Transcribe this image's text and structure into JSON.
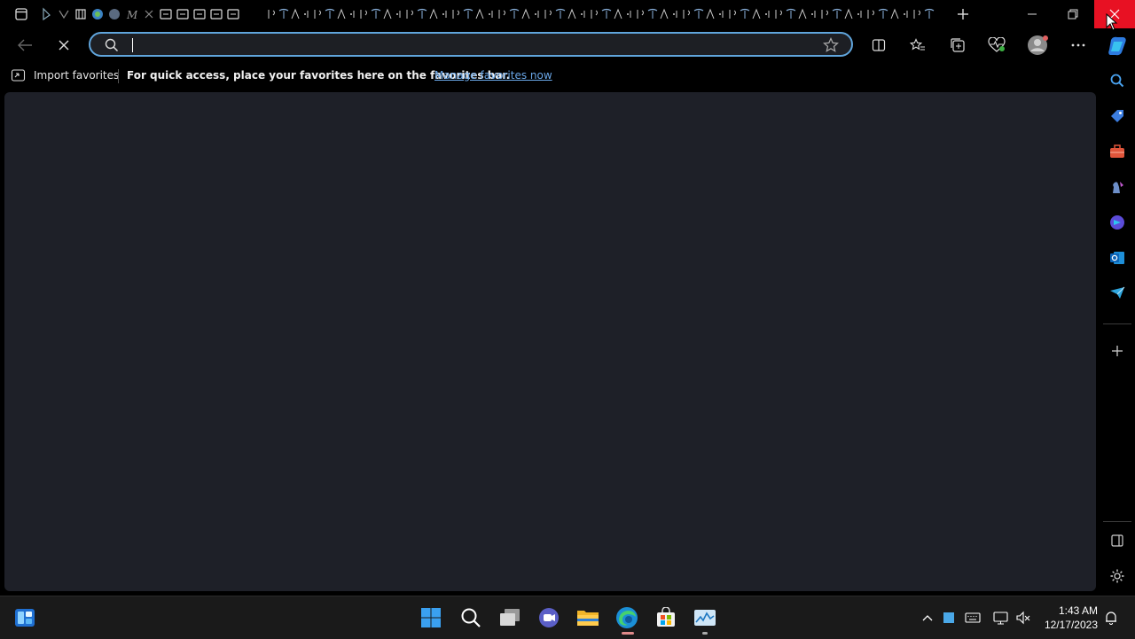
{
  "window": {
    "tab_count": 60,
    "new_tab_label": "+"
  },
  "toolbar": {
    "address_value": "",
    "address_placeholder": ""
  },
  "favorites_bar": {
    "import_label": "Import favorites",
    "message": "For quick access, place your favorites here on the favorites bar.",
    "manage_link": "Manage favorites now"
  },
  "sidebar": {
    "items": [
      "search-icon",
      "shopping-tag-icon",
      "tools-briefcase-icon",
      "games-icon",
      "copilot-icon",
      "outlook-icon",
      "telegram-icon"
    ]
  },
  "taskbar": {
    "apps": [
      "start-icon",
      "search-icon",
      "task-view-icon",
      "teams-icon",
      "file-explorer-icon",
      "edge-icon",
      "store-icon",
      "task-manager-icon"
    ],
    "clock": {
      "time": "1:43 AM",
      "date": "12/17/2023"
    }
  },
  "colors": {
    "address_focus_border": "#60a5dc",
    "content_background": "#1e2028",
    "close_hover": "#e81123",
    "link": "#6aa7e8"
  }
}
